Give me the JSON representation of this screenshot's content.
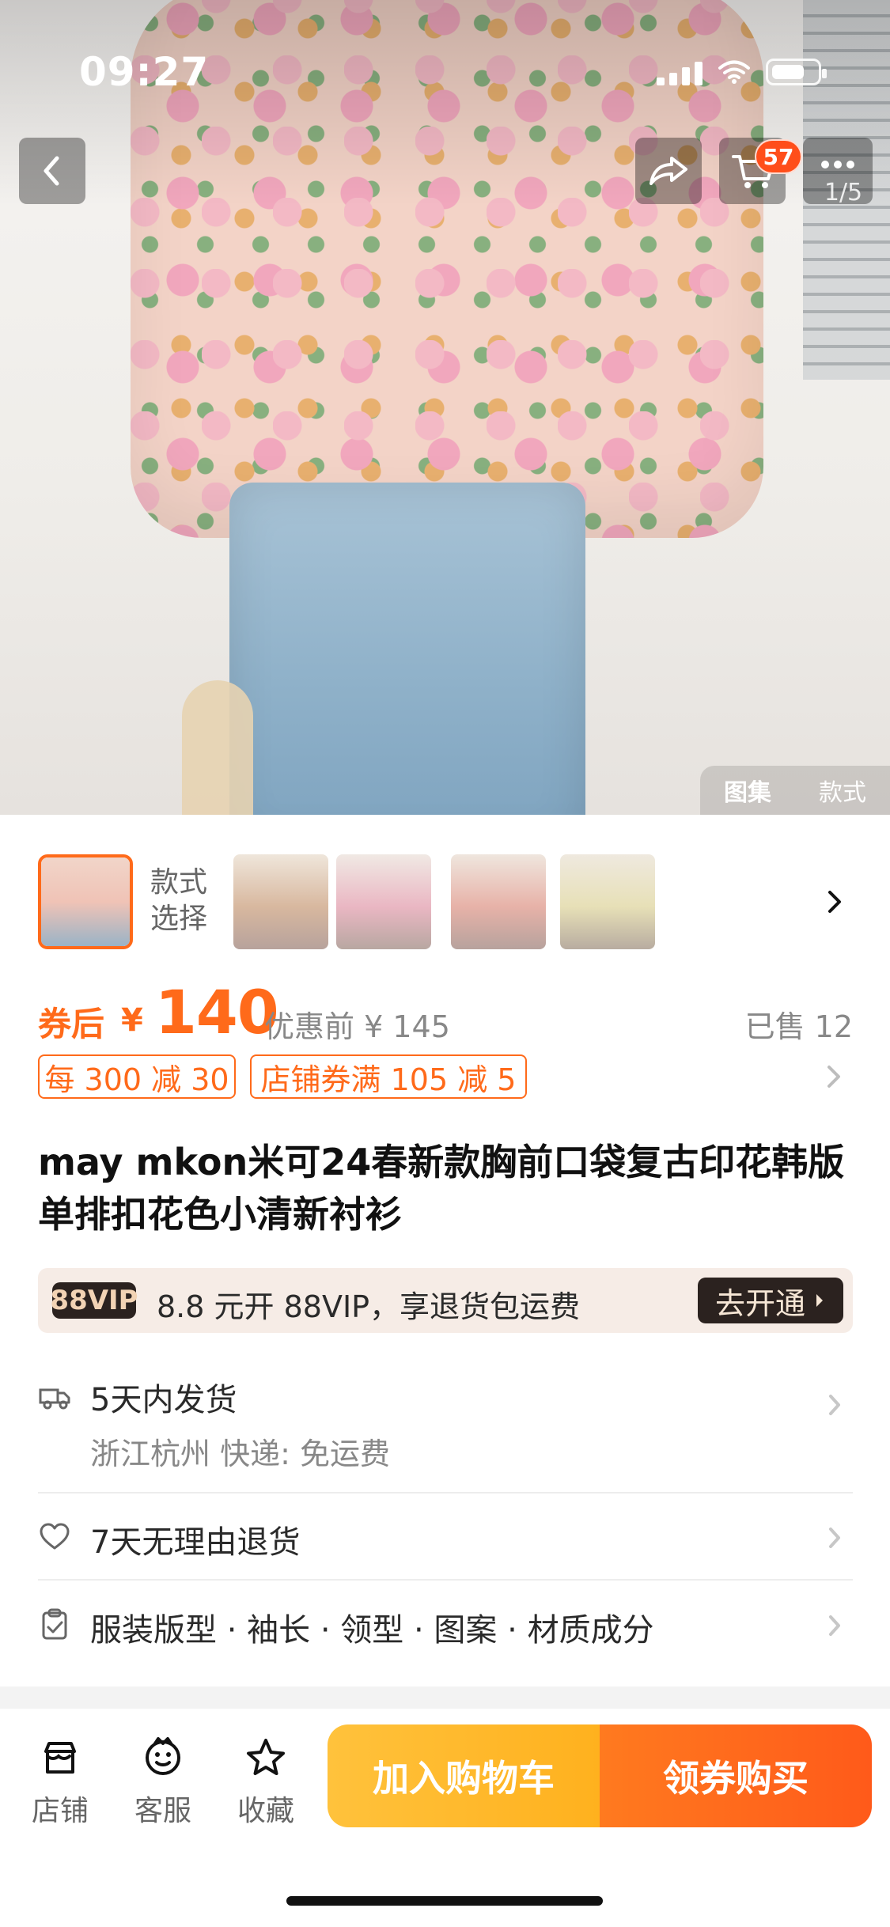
{
  "status_bar": {
    "time": "09:27"
  },
  "hero": {
    "cart_badge": "57",
    "page_indicator": "1/5",
    "tabs": [
      "图集",
      "款式"
    ]
  },
  "variants": {
    "label": "款式\n选择"
  },
  "pricing": {
    "coupon_prefix": "券后",
    "currency": "¥",
    "price": "140",
    "original_price_text": "优惠前 ¥ 145",
    "sold_text": "已售 12",
    "promos": [
      "每 300 减 30",
      "店铺券满 105 减 5"
    ]
  },
  "product": {
    "title": "may mkon米可24春新款胸前口袋复古印花韩版单排扣花色小清新衬衫"
  },
  "vip": {
    "logo": "88VIP",
    "text": "8.8 元开 88VIP，享退货包运费",
    "cta": "去开通"
  },
  "info": {
    "shipping_title": "5天内发货",
    "shipping_sub": "浙江杭州  快递: 免运费",
    "return_policy": "7天无理由退货",
    "params": "服装版型 · 袖长 · 领型 · 图案 · 材质成分"
  },
  "bottom_bar": {
    "items": [
      {
        "label": "店铺",
        "icon": "store-icon"
      },
      {
        "label": "客服",
        "icon": "customer-service-icon"
      },
      {
        "label": "收藏",
        "icon": "star-icon"
      }
    ],
    "cta_add": "加入购物车",
    "cta_buy": "领券购买"
  },
  "colors": {
    "accent_orange": "#ff6a1a",
    "badge_red": "#ff4e1a",
    "vip_bg": "#f6ece6",
    "vip_dark": "#2b221f"
  }
}
